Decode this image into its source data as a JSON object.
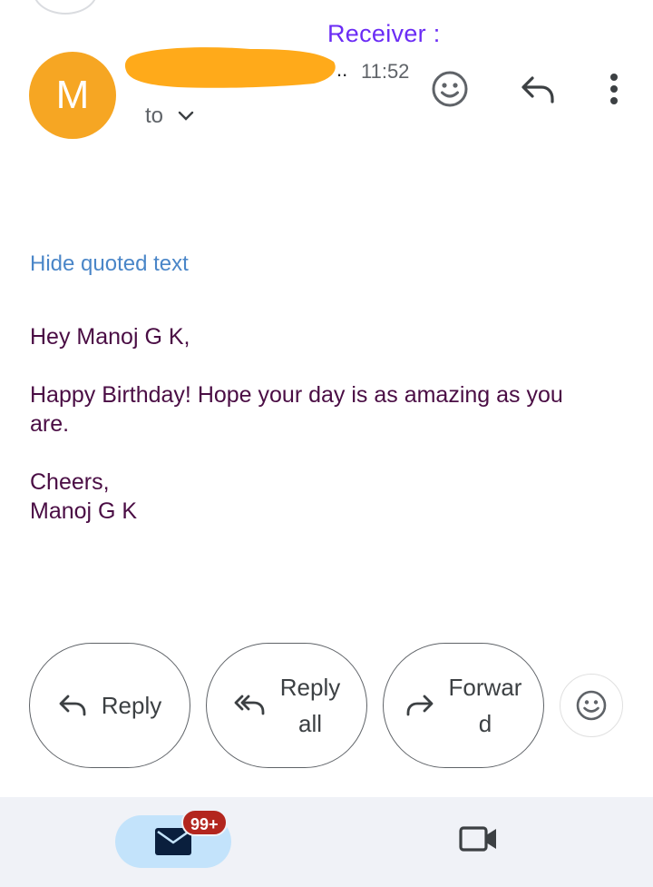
{
  "annotation": {
    "text": "Receiver :"
  },
  "header": {
    "avatar_letter": "M",
    "sender_trail": "..",
    "time": "11:52",
    "to_label": "to"
  },
  "message": {
    "hide_quoted": "Hide quoted text",
    "greeting": "Hey Manoj G K,",
    "body_line1": "Happy Birthday! Hope your day is as amazing as you",
    "body_line2": "are.",
    "signoff": "Cheers,",
    "signature": "Manoj G K"
  },
  "actions": {
    "reply": "Reply",
    "reply_all_line1": "Reply",
    "reply_all_line2": "all",
    "forward_line1": "Forwar",
    "forward_line2": "d"
  },
  "nav": {
    "badge": "99+"
  },
  "icons": {
    "emoji": "smiley-icon",
    "reply": "reply-icon",
    "reply_all": "reply-all-icon",
    "forward": "forward-icon",
    "more": "more-vert-icon",
    "mail": "mail-icon",
    "video": "video-icon"
  },
  "colors": {
    "avatar": "#f6a623",
    "annotation": "#6b2cf5",
    "link": "#4a86c8",
    "body_text": "#4a0d44",
    "redaction": "#ffaa1a",
    "badge": "#b3261e",
    "mail_pill": "#c3e3fb",
    "nav_bg": "#f0f2f7"
  }
}
